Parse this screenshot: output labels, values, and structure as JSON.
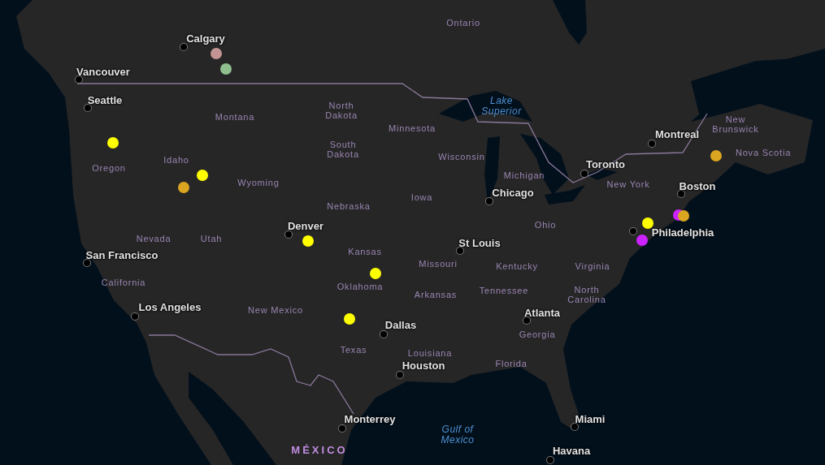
{
  "cities": [
    "Calgary",
    "Vancouver",
    "Seattle",
    "Montreal",
    "Toronto",
    "Chicago",
    "Boston",
    "Philadelphia",
    "Denver",
    "St Louis",
    "San Francisco",
    "Los Angeles",
    "Atlanta",
    "Dallas",
    "Houston",
    "Monterrey",
    "Miami",
    "Havana"
  ],
  "regions": [
    "Ontario",
    "Montana",
    "North Dakota",
    "Minnesota",
    "South Dakota",
    "Wisconsin",
    "Michigan",
    "Idaho",
    "Oregon",
    "Wyoming",
    "Iowa",
    "Nebraska",
    "New York",
    "Ohio",
    "Nevada",
    "Utah",
    "Kansas",
    "Missouri",
    "Kentucky",
    "Virginia",
    "California",
    "Oklahoma",
    "Arkansas",
    "Tennessee",
    "North Carolina",
    "New Mexico",
    "Georgia",
    "Texas",
    "Louisiana",
    "Florida",
    "New Brunswick",
    "Nova Scotia"
  ],
  "water": [
    "Lake Superior",
    "Gulf of Mexico"
  ],
  "countries": [
    "MÉXICO"
  ],
  "points": [
    {
      "color": "#c49494"
    },
    {
      "color": "#8fbf8f"
    },
    {
      "color": "#ffff00"
    },
    {
      "color": "#ffff00"
    },
    {
      "color": "#daa520"
    },
    {
      "color": "#ffff00"
    },
    {
      "color": "#ffff00"
    },
    {
      "color": "#ffff00"
    },
    {
      "color": "#daa520"
    },
    {
      "color": "#cc22ff"
    },
    {
      "color": "#ffff00"
    },
    {
      "color": "#daa520"
    },
    {
      "color": "#cc22ff"
    }
  ]
}
